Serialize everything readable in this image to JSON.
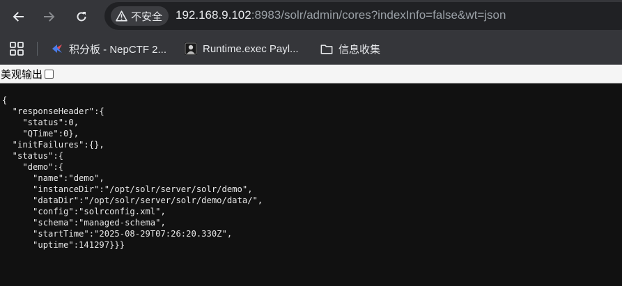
{
  "toolbar": {
    "security_label": "不安全",
    "url_host": "192.168.9.102",
    "url_rest": ":8983/solr/admin/cores?indexInfo=false&wt=json",
    "back_icon": "arrow-left-icon",
    "forward_icon": "arrow-right-icon",
    "reload_icon": "reload-icon"
  },
  "bookmarks": {
    "items": [
      {
        "label": "积分板 - NepCTF 2...",
        "icon": "nepctf-favicon"
      },
      {
        "label": "Runtime.exec Payl...",
        "icon": "runtime-favicon"
      },
      {
        "label": "信息收集",
        "icon": "folder-icon"
      }
    ]
  },
  "viewer": {
    "pretty_print_label": "美观输出",
    "pretty_print_checked": false
  },
  "json_lines": [
    "{",
    "  \"responseHeader\":{",
    "    \"status\":0,",
    "    \"QTime\":0},",
    "  \"initFailures\":{},",
    "  \"status\":{",
    "    \"demo\":{",
    "      \"name\":\"demo\",",
    "      \"instanceDir\":\"/opt/solr/server/solr/demo\",",
    "      \"dataDir\":\"/opt/solr/server/solr/demo/data/\",",
    "      \"config\":\"solrconfig.xml\",",
    "      \"schema\":\"managed-schema\",",
    "      \"startTime\":\"2025-08-29T07:26:20.330Z\",",
    "      \"uptime\":141297}}}"
  ],
  "colors": {
    "toolbar_bg": "#35363a",
    "omnibox_bg": "#202124",
    "page_bg": "#111111",
    "text": "#e8eaed"
  }
}
